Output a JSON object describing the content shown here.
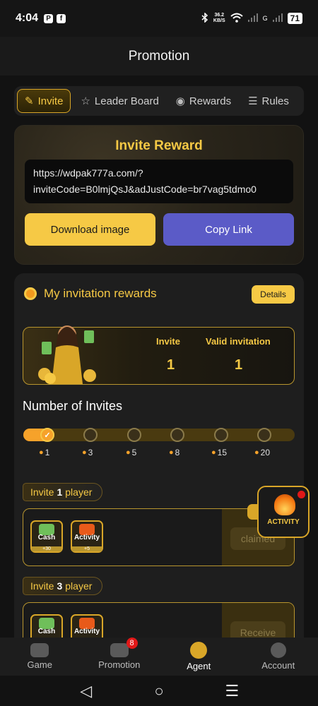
{
  "status_bar": {
    "time": "4:04",
    "speed_top": "36.2",
    "speed_bottom": "KB/S",
    "network": "G",
    "battery": "71"
  },
  "header": {
    "title": "Promotion"
  },
  "tabs": [
    {
      "label": "Invite",
      "icon": "invite-icon",
      "active": true
    },
    {
      "label": "Leader Board",
      "icon": "trophy-icon",
      "active": false
    },
    {
      "label": "Rewards",
      "icon": "medal-icon",
      "active": false
    },
    {
      "label": "Rules",
      "icon": "document-icon",
      "active": false
    }
  ],
  "invite_card": {
    "title": "Invite Reward",
    "link_line1": "https://wdpak777a.com/?",
    "link_line2": "inviteCode=B0lmjQsJ&adJustCode=br7vag5tdmo0",
    "download_label": "Download image",
    "copy_label": "Copy Link"
  },
  "my_rewards": {
    "title": "My invitation rewards",
    "details_label": "Details",
    "invite_label": "Invite",
    "invite_value": "1",
    "valid_label": "Valid invitation",
    "valid_value": "1"
  },
  "invites_progress": {
    "title": "Number of Invites",
    "current": 1,
    "milestones": [
      "1",
      "3",
      "5",
      "8",
      "15",
      "20"
    ],
    "checkmark": "✓"
  },
  "levels": [
    {
      "prefix": "Invite",
      "count": "1",
      "suffix": "player",
      "cash_label": "Cash",
      "cash_amount": "+30",
      "activity_label": "Activity",
      "activity_amount": "+5",
      "state": "claimed"
    },
    {
      "prefix": "Invite",
      "count": "3",
      "suffix": "player",
      "cash_label": "Cash",
      "activity_label": "Activity",
      "state": "Receive"
    }
  ],
  "activity_float": {
    "label": "ACTIVITY"
  },
  "bottom_nav": {
    "items": [
      {
        "label": "Game",
        "icon": "gamepad-icon"
      },
      {
        "label": "Promotion",
        "icon": "gift-icon",
        "badge": "8"
      },
      {
        "label": "Agent",
        "icon": "coin-icon",
        "active": true
      },
      {
        "label": "Account",
        "icon": "account-icon"
      }
    ]
  },
  "system_nav": {
    "back": "◁",
    "home": "○",
    "recents": "☰"
  },
  "colors": {
    "accent": "#f6c945",
    "primary_button": "#5b5bc7",
    "badge": "#e01818",
    "background": "#121212"
  }
}
